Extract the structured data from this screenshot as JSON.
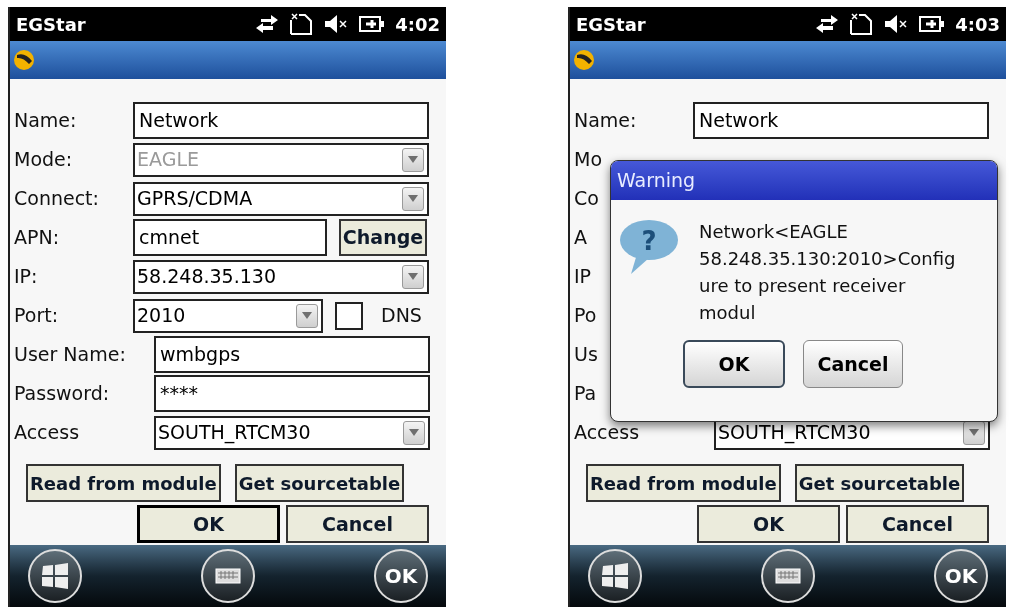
{
  "screens": [
    {
      "status_bar": {
        "app": "EGStar",
        "time": "4:02"
      },
      "form": {
        "sections": [
          {
            "rows": [
              {
                "kind": "text",
                "label": "Name:",
                "value": "Network"
              },
              {
                "kind": "dropdown",
                "label": "Mode:",
                "value": "EAGLE",
                "disabled": true
              },
              {
                "kind": "dropdown",
                "label": "Connect:",
                "value": "GPRS/CDMA",
                "disabled": false
              },
              {
                "kind": "text",
                "label": "APN:",
                "value": "cmnet",
                "button": "Change"
              },
              {
                "kind": "dropdown",
                "label": "IP:",
                "value": "58.248.35.130",
                "disabled": false
              },
              {
                "kind": "dropdown",
                "label": "Port:",
                "value": "2010",
                "disabled": false,
                "checkbox": {
                  "label": "DNS",
                  "checked": false
                }
              }
            ]
          },
          {
            "rows": [
              {
                "kind": "text",
                "label": "User Name:",
                "value": "wmbgps"
              },
              {
                "kind": "text",
                "label": "Password:",
                "value": "****"
              },
              {
                "kind": "dropdown",
                "label": "Access",
                "value": "SOUTH_RTCM30",
                "disabled": false
              }
            ]
          }
        ]
      },
      "actions": [
        {
          "label": "Read from module"
        },
        {
          "label": "Get sourcetable"
        }
      ],
      "buttons": [
        {
          "label": "OK",
          "focused": true
        },
        {
          "label": "Cancel",
          "focused": false
        }
      ],
      "softkey_ok": "OK"
    },
    {
      "status_bar": {
        "app": "EGStar",
        "time": "4:03"
      },
      "form": {
        "sections": [
          {
            "rows": [
              {
                "kind": "text",
                "label": "Name:",
                "value": "Network"
              },
              {
                "kind": "covered",
                "label": "Mo"
              },
              {
                "kind": "covered",
                "label": "Co"
              },
              {
                "kind": "covered",
                "label": "A"
              },
              {
                "kind": "covered",
                "label": "IP"
              },
              {
                "kind": "covered",
                "label": "Po"
              }
            ]
          },
          {
            "rows": [
              {
                "kind": "covered",
                "label": "Us"
              },
              {
                "kind": "covered",
                "label": "Pa"
              },
              {
                "kind": "dropdown",
                "label": "Access",
                "value": "SOUTH_RTCM30",
                "disabled": false
              }
            ]
          }
        ]
      },
      "dialog": {
        "title": "Warning",
        "icon_glyph": "?",
        "message": "Network<EAGLE\n58.248.35.130:2010>Config\nure to present receiver\nmodul",
        "buttons": [
          {
            "label": "OK",
            "focused": true
          },
          {
            "label": "Cancel",
            "focused": false
          }
        ]
      },
      "actions": [
        {
          "label": "Read from module"
        },
        {
          "label": "Get sourcetable"
        }
      ],
      "buttons": [
        {
          "label": "OK",
          "focused": false
        },
        {
          "label": "Cancel",
          "focused": false
        }
      ],
      "softkey_ok": "OK"
    }
  ]
}
